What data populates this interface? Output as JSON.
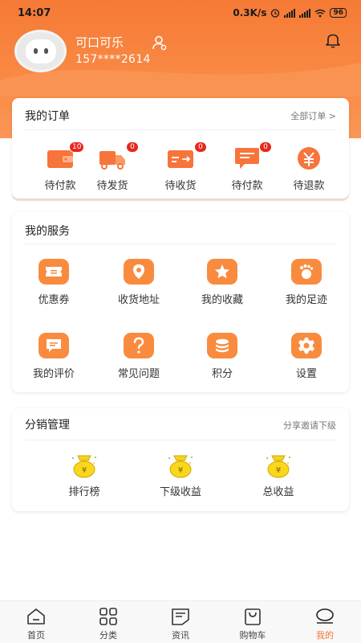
{
  "status": {
    "time": "14:07",
    "speed": "0.3K/s",
    "battery": "96"
  },
  "user": {
    "name": "可口可乐",
    "phone": "157****2614"
  },
  "orders": {
    "title": "我的订单",
    "all_link": "全部订单 >",
    "items": [
      {
        "label": "待付款",
        "badge": "10",
        "icon": "wallet-icon"
      },
      {
        "label": "待发货",
        "badge": "0",
        "icon": "truck-icon"
      },
      {
        "label": "待收货",
        "badge": "0",
        "icon": "receive-icon"
      },
      {
        "label": "待付款",
        "badge": "0",
        "icon": "comment-icon"
      },
      {
        "label": "待退款",
        "badge": "",
        "icon": "refund-icon"
      }
    ]
  },
  "services": {
    "title": "我的服务",
    "items": [
      {
        "label": "优惠券",
        "icon": "coupon-icon"
      },
      {
        "label": "收货地址",
        "icon": "location-icon"
      },
      {
        "label": "我的收藏",
        "icon": "star-icon"
      },
      {
        "label": "我的足迹",
        "icon": "footprint-icon"
      },
      {
        "label": "我的评价",
        "icon": "review-icon"
      },
      {
        "label": "常见问题",
        "icon": "question-icon"
      },
      {
        "label": "积分",
        "icon": "points-icon"
      },
      {
        "label": "设置",
        "icon": "gear-icon"
      }
    ]
  },
  "distribution": {
    "title": "分销管理",
    "link": "分享邀请下级",
    "items": [
      {
        "label": "排行榜",
        "icon": "money-bag-icon"
      },
      {
        "label": "下级收益",
        "icon": "money-bag-icon"
      },
      {
        "label": "总收益",
        "icon": "money-bag-icon"
      }
    ]
  },
  "tabs": [
    {
      "label": "首页",
      "icon": "home-icon"
    },
    {
      "label": "分类",
      "icon": "category-icon"
    },
    {
      "label": "资讯",
      "icon": "news-icon"
    },
    {
      "label": "购物车",
      "icon": "cart-icon"
    },
    {
      "label": "我的",
      "icon": "profile-icon",
      "active": true
    }
  ],
  "colors": {
    "accent": "#f98b3e",
    "badge": "#e8271d",
    "header": "#f57a35"
  }
}
